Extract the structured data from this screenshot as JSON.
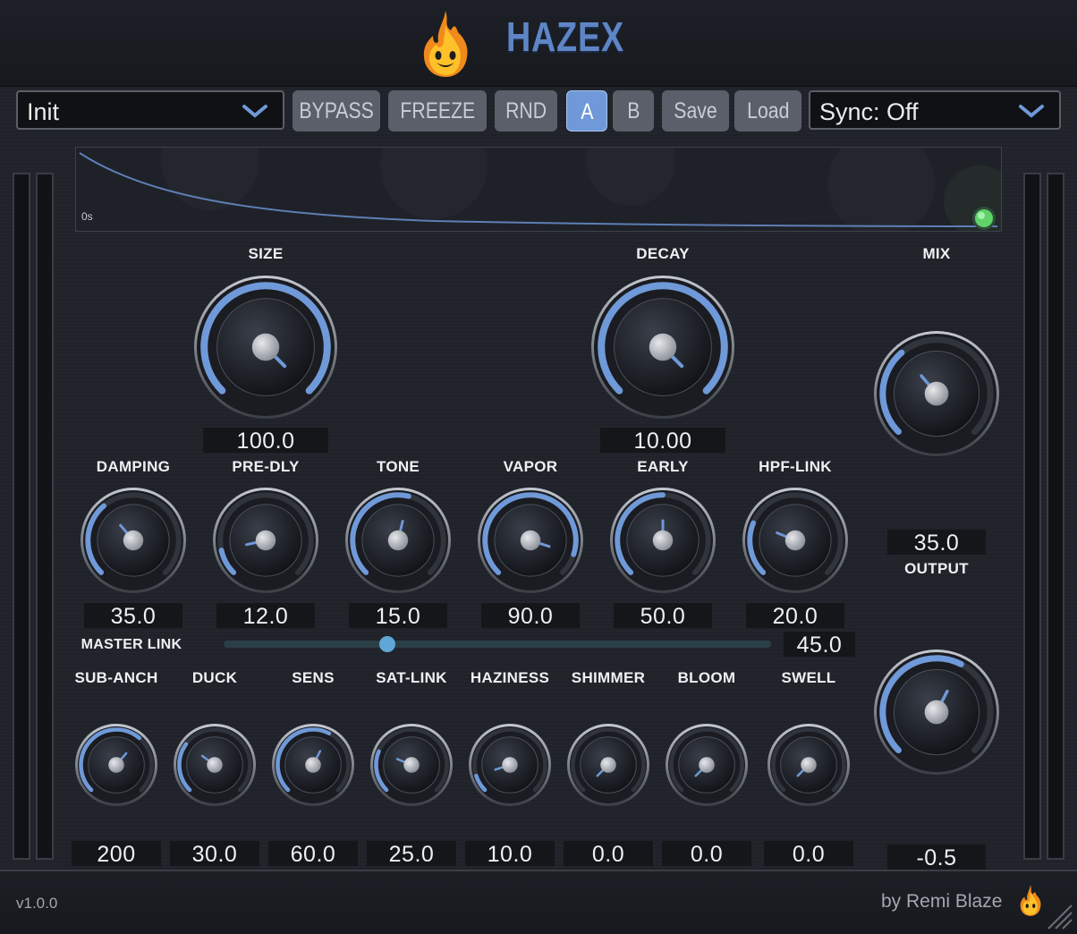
{
  "app": {
    "title": "HAZEX",
    "version": "v1.0.0",
    "byline": "by Remi Blaze"
  },
  "colors": {
    "accent": "#6f99d8",
    "title": "#5e86c6",
    "panel": "#22252c",
    "value_bg": "#14161a",
    "led": "#5fd36a"
  },
  "toolbar": {
    "preset": {
      "value": "Init"
    },
    "buttons": [
      {
        "id": "bypass",
        "label": "BYPASS",
        "active": false
      },
      {
        "id": "freeze",
        "label": "FREEZE",
        "active": false
      },
      {
        "id": "rnd",
        "label": "RND",
        "active": false
      },
      {
        "id": "a",
        "label": "A",
        "active": true
      },
      {
        "id": "b",
        "label": "B",
        "active": false
      },
      {
        "id": "save",
        "label": "Save",
        "active": false
      },
      {
        "id": "load",
        "label": "Load",
        "active": false
      }
    ],
    "sync": {
      "value": "Sync: Off"
    }
  },
  "display": {
    "time_label": "0s"
  },
  "big_knobs": [
    {
      "id": "size",
      "label": "SIZE",
      "value": "100.0",
      "level": 1.0
    },
    {
      "id": "decay",
      "label": "DECAY",
      "value": "10.00",
      "level": 1.0
    }
  ],
  "mix": {
    "label": "MIX",
    "value": "35.0",
    "level": 0.35
  },
  "output": {
    "label": "OUTPUT",
    "value": "-0.5",
    "level": 0.6
  },
  "mid_knobs": [
    {
      "id": "damping",
      "label": "DAMPING",
      "value": "35.0",
      "level": 0.35
    },
    {
      "id": "pre-dly",
      "label": "PRE-DLY",
      "value": "12.0",
      "level": 0.12
    },
    {
      "id": "tone",
      "label": "TONE",
      "value": "15.0",
      "level": 0.55
    },
    {
      "id": "vapor",
      "label": "VAPOR",
      "value": "90.0",
      "level": 0.9
    },
    {
      "id": "early",
      "label": "EARLY",
      "value": "50.0",
      "level": 0.5
    },
    {
      "id": "hpf-link",
      "label": "HPF-LINK",
      "value": "20.0",
      "level": 0.25
    }
  ],
  "master_link": {
    "label": "MASTER LINK",
    "value": "45.0",
    "level": 0.3
  },
  "small_knobs": [
    {
      "id": "sub-anch",
      "label": "SUB-ANCH",
      "value": "200",
      "level": 0.65
    },
    {
      "id": "duck",
      "label": "DUCK",
      "value": "30.0",
      "level": 0.3
    },
    {
      "id": "sens",
      "label": "SENS",
      "value": "60.0",
      "level": 0.6
    },
    {
      "id": "sat-link",
      "label": "SAT-LINK",
      "value": "25.0",
      "level": 0.25
    },
    {
      "id": "haziness",
      "label": "HAZINESS",
      "value": "10.0",
      "level": 0.1
    },
    {
      "id": "shimmer",
      "label": "SHIMMER",
      "value": "0.0",
      "level": 0.0
    },
    {
      "id": "bloom",
      "label": "BLOOM",
      "value": "0.0",
      "level": 0.0
    },
    {
      "id": "swell",
      "label": "SWELL",
      "value": "0.0",
      "level": 0.0
    }
  ]
}
